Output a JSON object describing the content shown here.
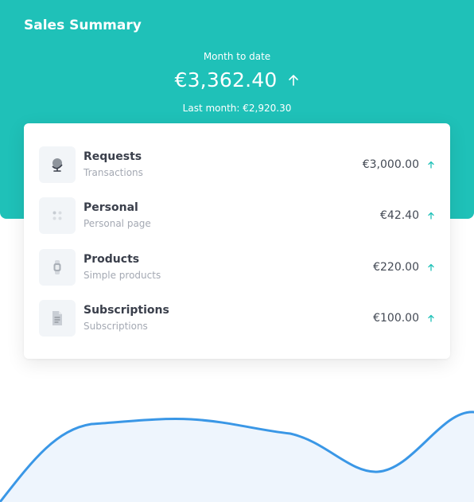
{
  "header": {
    "title": "Sales Summary",
    "month_to_date_label": "Month to date",
    "month_to_date_value": "€3,362.40",
    "last_month_text": "Last month: €2,920.30",
    "trend_icon": "arrow-up-icon"
  },
  "colors": {
    "accent": "#1fc1b8",
    "wave_line": "#3a97e6",
    "wave_fill": "#eef5fd"
  },
  "items": [
    {
      "name": "Requests",
      "sub": "Transactions",
      "amount": "€3,000.00",
      "icon": "globe-icon",
      "trend_icon": "arrow-up-icon"
    },
    {
      "name": "Personal",
      "sub": "Personal page",
      "amount": "€42.40",
      "icon": "dots-grid-icon",
      "trend_icon": "arrow-up-icon"
    },
    {
      "name": "Products",
      "sub": "Simple products",
      "amount": "€220.00",
      "icon": "watch-icon",
      "trend_icon": "arrow-up-icon"
    },
    {
      "name": "Subscriptions",
      "sub": "Subscriptions",
      "amount": "€100.00",
      "icon": "document-icon",
      "trend_icon": "arrow-up-icon"
    }
  ]
}
